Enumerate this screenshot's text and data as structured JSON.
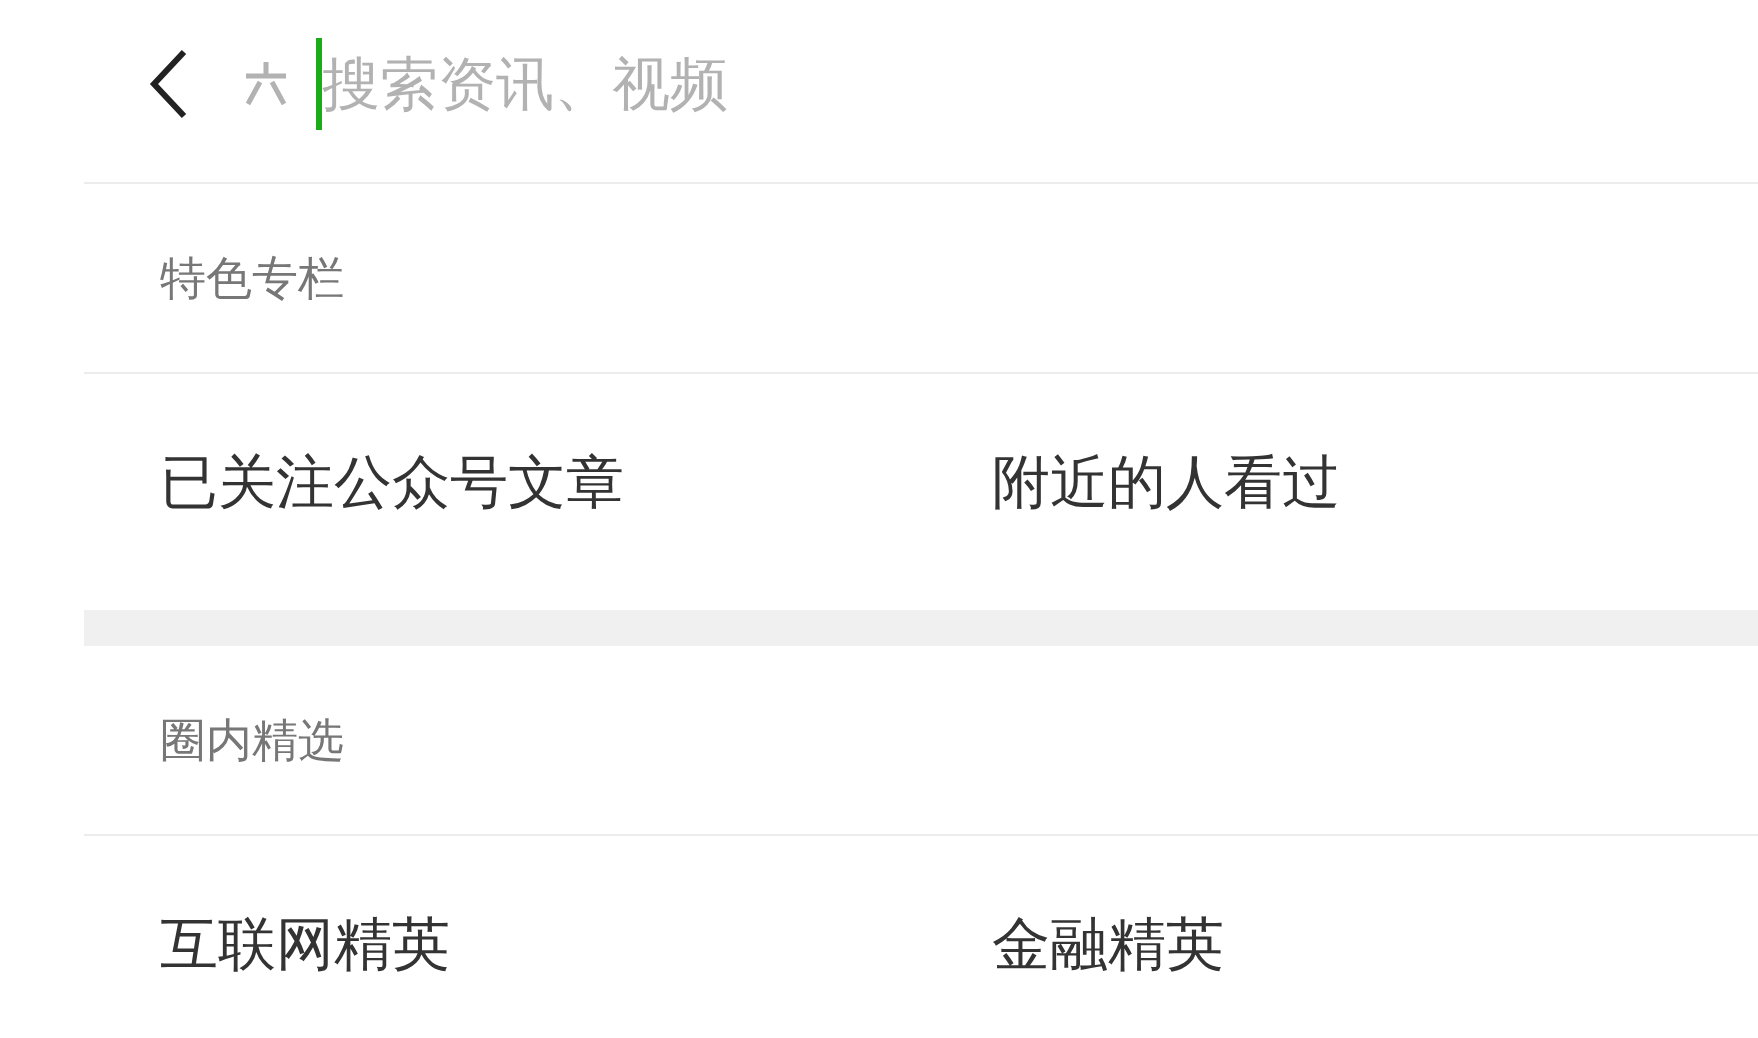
{
  "search": {
    "placeholder": "搜索资讯、视频"
  },
  "sections": [
    {
      "title": "特色专栏",
      "items": [
        "已关注公众号文章",
        "附近的人看过"
      ]
    },
    {
      "title": "圈内精选",
      "items": [
        "互联网精英",
        "金融精英"
      ]
    }
  ]
}
